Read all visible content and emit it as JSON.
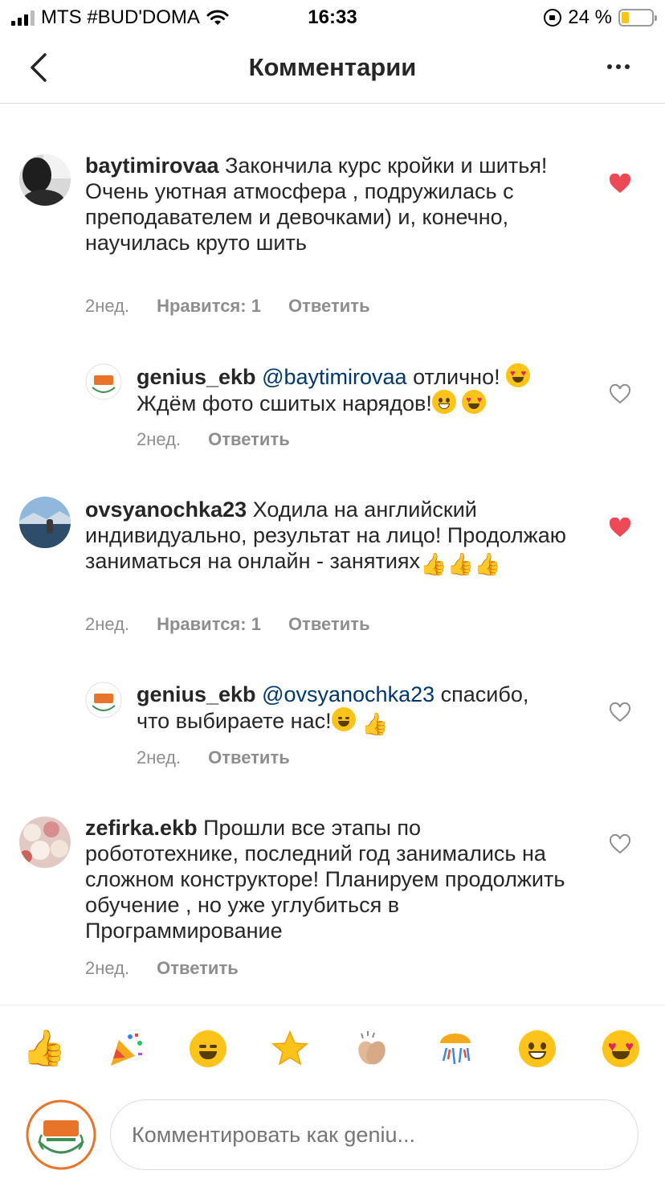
{
  "status_bar": {
    "carrier": "MTS #BUD'DOMA",
    "time": "16:33",
    "battery": "24 %",
    "battery_level": 0.24
  },
  "header": {
    "title": "Комментарии"
  },
  "comments": [
    {
      "username": "baytimirovaa",
      "text": "Закончила курс кройки и шитья! Очень уютная атмосфера , подружилась с преподавателем и девочками) и, конечно, научилась круто шить",
      "time": "2нед.",
      "likes": "Нравится: 1",
      "reply": "Ответить",
      "liked": true
    },
    {
      "username": "genius_ekb",
      "mention": "@baytimirovaa",
      "text_line1": "отлично!",
      "text_line2": "Ждём фото сшитых нарядов!",
      "time": "2нед.",
      "reply": "Ответить",
      "liked": false
    },
    {
      "username": "ovsyanochka23",
      "text": "Ходила на английский индивидуально, результат на лицо! Продолжаю заниматься на онлайн - занятиях",
      "time": "2нед.",
      "likes": "Нравится: 1",
      "reply": "Ответить",
      "liked": true
    },
    {
      "username": "genius_ekb",
      "mention": "@ovsyanochka23",
      "text_line1": "спасибо,",
      "text_line2": "что выбираете нас!",
      "time": "2нед.",
      "reply": "Ответить",
      "liked": false
    },
    {
      "username": "zefirka.ekb",
      "text": "Прошли все этапы по робототехнике, последний год занимались на сложном конструкторе! Планируем продолжить обучение , но уже углубиться в Программирование",
      "time": "2нед.",
      "reply": "Ответить",
      "liked": false
    }
  ],
  "emoji_bar": [
    "thumbs-up",
    "party-popper",
    "smiling-face",
    "glowing-star",
    "clapping-hands",
    "confetti-ball",
    "grinning-face",
    "heart-eyes-face"
  ],
  "comment_input": {
    "placeholder": "Комментировать как geniu..."
  },
  "colors": {
    "like_red": "#ed4956",
    "text": "#262626",
    "muted": "#8e8e8e",
    "mention": "#00376b",
    "brand_orange": "#e8742a"
  }
}
